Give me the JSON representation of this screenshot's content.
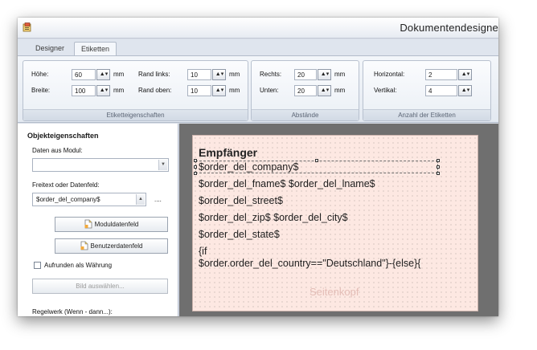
{
  "window": {
    "title": "Dokumentendesigne"
  },
  "tabs": [
    "Designer",
    "Etiketten"
  ],
  "ribbon": {
    "etiketteigenschaften": {
      "caption": "Etiketteigenschaften",
      "hoehe_label": "Höhe:",
      "hoehe_value": "60",
      "breite_label": "Breite:",
      "breite_value": "100",
      "rand_links_label": "Rand links:",
      "rand_links_value": "10",
      "rand_oben_label": "Rand oben:",
      "rand_oben_value": "10",
      "unit": "mm"
    },
    "abstaende": {
      "caption": "Abstände",
      "rechts_label": "Rechts:",
      "rechts_value": "20",
      "unten_label": "Unten:",
      "unten_value": "20",
      "unit": "mm"
    },
    "anzahl": {
      "caption": "Anzahl der Etiketten",
      "horizontal_label": "Horizontal:",
      "horizontal_value": "2",
      "vertikal_label": "Vertikal:",
      "vertikal_value": "4"
    }
  },
  "objekteigenschaften": {
    "title": "Objekteigenschaften",
    "daten_label": "Daten aus Modul:",
    "daten_value": "",
    "freitext_label": "Freitext oder Datenfeld:",
    "freitext_value": "$order_del_company$",
    "more_label": "....",
    "moduldatenfeld_label": "Moduldatenfeld",
    "benutzerdatenfeld_label": "Benutzerdatenfeld",
    "aufrunden_label": "Aufrunden als Währung",
    "bild_label": "Bild auswählen...",
    "regelwerk_label": "Regelwerk (Wenn - dann...):"
  },
  "canvas": {
    "heading": "Empfänger",
    "lines": [
      "$order_del_company$",
      "$order_del_fname$ $order_del_lname$",
      "$order_del_street$",
      "$order_del_zip$ $order_del_city$",
      "$order_del_state$",
      "{if",
      "$order.order_del_country==\"Deutschland\"}-{else}{"
    ],
    "band_label": "Seitenkopf"
  },
  "icons": {
    "app": "app-icon",
    "spin": "spin-up-down-icon",
    "dropdown": "chevron-down-icon",
    "document": "document-icon"
  }
}
